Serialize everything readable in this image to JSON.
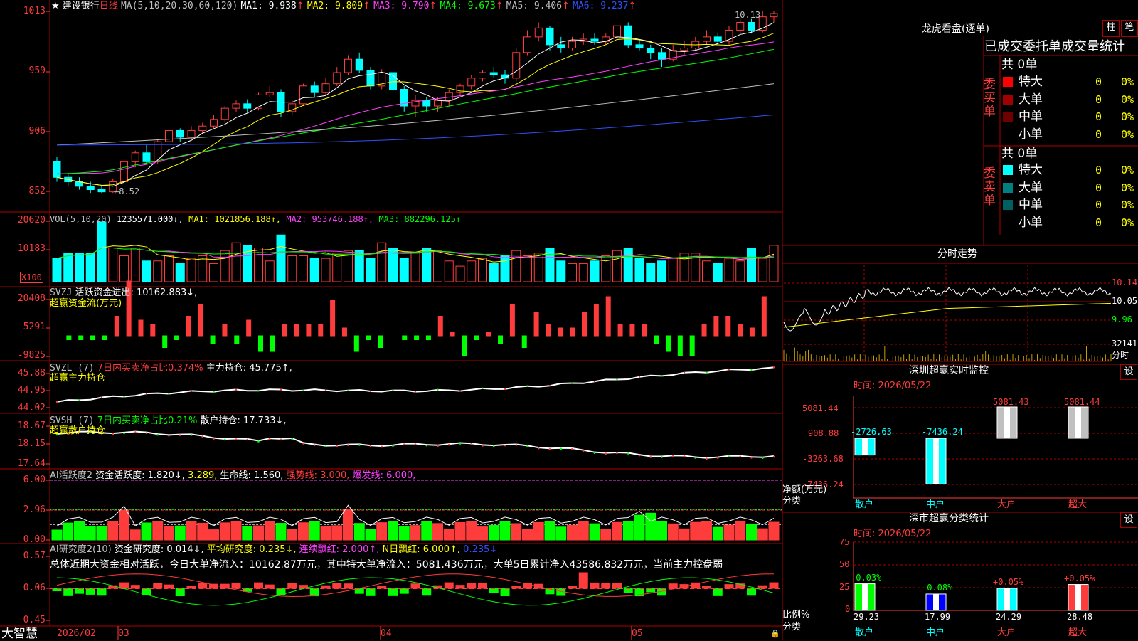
{
  "colors": {
    "up": "#ff3c3c",
    "down": "#00ffff",
    "ma1": "#ffffff",
    "ma2": "#ffff00",
    "ma3": "#ff40ff",
    "ma4": "#00ff00",
    "ma5": "#c0c0c0",
    "ma6": "#3050ff",
    "grid": "#a00000"
  },
  "header": {
    "star": "★",
    "stock_name": "建设银行",
    "period": "日线",
    "ma_label": "MA(5,10,20,30,60,120)",
    "ma1": "MA1: 9.938",
    "ma2": "MA2: 9.809",
    "ma3": "MA3: 9.790",
    "ma4": "MA4: 9.673",
    "ma5": "MA5: 9.406",
    "ma6": "MA6: 9.237",
    "arrow": "↑"
  },
  "price_axis": [
    "1013",
    "959",
    "906",
    "852"
  ],
  "price_high_label": "10.13",
  "price_low_label": "←8.52",
  "vol": {
    "label": "VOL(5,10,20)",
    "value": "1235571.000↓,",
    "ma1": "MA1: 1021856.188↑,",
    "ma2": "MA2: 953746.188↑,",
    "ma3": "MA3: 882296.125↑",
    "axis": [
      "20620",
      "10183"
    ],
    "unit": "X100"
  },
  "svzj": {
    "label": "SVZJ",
    "title": "活跃资金进出: 10162.883↓,",
    "sub": "超赢资金流(万元)",
    "axis": [
      "20408",
      "5291",
      "-9825"
    ]
  },
  "svzl": {
    "label": "SVZL (7)",
    "pct": "7日内买卖净占比0.374%",
    "hold": "主力持仓: 45.775↑,",
    "sub": "超赢主力持仓",
    "axis": [
      "45.88",
      "44.95",
      "44.02"
    ]
  },
  "svsh": {
    "label": "SVSH (7)",
    "pct": "7日内买卖净占比0.21%",
    "hold": "散户持仓: 17.733↓,",
    "sub": "超赢散户持仓",
    "axis": [
      "18.67",
      "18.15",
      "17.64"
    ]
  },
  "ai1": {
    "label": "AI活跃度2",
    "a": "资金活跃度: 1.820↓,",
    "b": "3.289,",
    "c": "生命线: 1.560,",
    "d": "强势线: 3.000,",
    "e": "爆发线: 6.000,",
    "axis": [
      "6.00",
      "2.96",
      "0.00"
    ]
  },
  "ai2": {
    "label": "AI研究度2(10)",
    "a": "资金研究度: 0.014↓,",
    "b": "平均研究度: 0.235↓,",
    "c": "连续飘红: 2.000↑,",
    "d": "N日飘红: 6.000↑,",
    "e": "0.235↓",
    "summary": "总体近期大资金相对活跃，今日大单净流入：10162.87万元，其中特大单净流入：5081.436万元，大单5日累计净入43586.832万元，当前主力控盘弱",
    "axis": [
      "0.57",
      "0.06",
      "-0.45"
    ]
  },
  "bottom_axis": {
    "brand": "大智慧",
    "dates": [
      "2026/02",
      "03",
      "04",
      "05"
    ]
  },
  "longhu": {
    "title": "龙虎看盘(逐单)",
    "btn1": "柱",
    "btn2": "笔",
    "tabs": "已成交委托单成交量统计",
    "buy_count": "共 0单",
    "sell_count": "共 0单",
    "buy_side": "委买单",
    "sell_side": "委卖单",
    "buy_rows": [
      {
        "name": "特大",
        "val": "0",
        "pct": "0%",
        "color": "#ff0000"
      },
      {
        "name": "大单",
        "val": "0",
        "pct": "0%",
        "color": "#a00000"
      },
      {
        "name": "中单",
        "val": "0",
        "pct": "0%",
        "color": "#700000"
      },
      {
        "name": "小单",
        "val": "0",
        "pct": "0%",
        "color": "#000000"
      }
    ],
    "sell_rows": [
      {
        "name": "特大",
        "val": "0",
        "pct": "0%",
        "color": "#00ffff"
      },
      {
        "name": "大单",
        "val": "0",
        "pct": "0%",
        "color": "#008080"
      },
      {
        "name": "中单",
        "val": "0",
        "pct": "0%",
        "color": "#006060"
      },
      {
        "name": "小单",
        "val": "0",
        "pct": "0%",
        "color": "#000000"
      }
    ]
  },
  "intraday": {
    "title": "分时走势",
    "axis": [
      "10.14",
      "10.05",
      "9.96",
      "32141"
    ],
    "foot": "分时"
  },
  "sz_monitor": {
    "title": "深圳超赢实时监控",
    "btn": "设",
    "time": "时间: 2026/05/22",
    "axis": [
      "5081.44",
      "908.88",
      "-3263.68",
      "-7436.24"
    ],
    "ylabel": "净额(万元)",
    "xlabel": "分类",
    "bars": [
      {
        "name": "散户",
        "value": -2726.63,
        "label": "-2726.63"
      },
      {
        "name": "中户",
        "value": -7436.24,
        "label": "-7436.24"
      },
      {
        "name": "大户",
        "value": 5081.43,
        "label": "5081.43"
      },
      {
        "name": "超大",
        "value": 5081.44,
        "label": "5081.44"
      }
    ]
  },
  "sz_class": {
    "title": "深市超赢分类统计",
    "btn": "设",
    "time": "时间: 2026/05/22",
    "axis": [
      "75",
      "50",
      "25",
      "0"
    ],
    "ylabel": "比例%",
    "xlabel": "分类",
    "bars": [
      {
        "name": "散户",
        "value": 29.23,
        "label": "29.23",
        "chg": "-0.03%"
      },
      {
        "name": "中户",
        "value": 17.99,
        "label": "17.99",
        "chg": "-0.08%"
      },
      {
        "name": "大户",
        "value": 24.29,
        "label": "24.29",
        "chg": "+0.05%"
      },
      {
        "name": "超大",
        "value": 28.48,
        "label": "28.48",
        "chg": "+0.05%"
      }
    ]
  },
  "chart_data": [
    {
      "type": "candlestick",
      "title": "建设银行 日线",
      "ylim": [
        8.4,
        10.2
      ],
      "x": [
        "2026/02",
        "03",
        "04",
        "05"
      ],
      "series": [
        {
          "name": "K",
          "values": [
            [
              8.8,
              8.66,
              8.84,
              8.62
            ],
            [
              8.66,
              8.62,
              8.7,
              8.58
            ],
            [
              8.62,
              8.58,
              8.66,
              8.55
            ],
            [
              8.58,
              8.55,
              8.62,
              8.52
            ],
            [
              8.55,
              8.53,
              8.58,
              8.52
            ],
            [
              8.53,
              8.62,
              8.65,
              8.52
            ],
            [
              8.62,
              8.8,
              8.82,
              8.6
            ],
            [
              8.8,
              8.88,
              8.9,
              8.75
            ],
            [
              8.88,
              8.8,
              8.95,
              8.78
            ],
            [
              8.8,
              8.98,
              9.0,
              8.78
            ],
            [
              8.98,
              9.08,
              9.12,
              8.95
            ],
            [
              9.08,
              9.02,
              9.1,
              8.98
            ],
            [
              9.02,
              9.08,
              9.12,
              9.0
            ],
            [
              9.08,
              9.12,
              9.15,
              9.05
            ],
            [
              9.12,
              9.18,
              9.22,
              9.1
            ],
            [
              9.18,
              9.28,
              9.3,
              9.15
            ],
            [
              9.28,
              9.32,
              9.35,
              9.25
            ],
            [
              9.32,
              9.28,
              9.36,
              9.24
            ],
            [
              9.28,
              9.4,
              9.42,
              9.26
            ],
            [
              9.4,
              9.42,
              9.48,
              9.38
            ],
            [
              9.42,
              9.25,
              9.45,
              9.2
            ],
            [
              9.25,
              9.32,
              9.35,
              9.22
            ],
            [
              9.32,
              9.48,
              9.5,
              9.3
            ],
            [
              9.48,
              9.42,
              9.52,
              9.38
            ],
            [
              9.42,
              9.5,
              9.55,
              9.4
            ],
            [
              9.5,
              9.6,
              9.65,
              9.48
            ],
            [
              9.6,
              9.72,
              9.75,
              9.58
            ],
            [
              9.72,
              9.62,
              9.78,
              9.6
            ],
            [
              9.62,
              9.48,
              9.65,
              9.45
            ],
            [
              9.48,
              9.6,
              9.63,
              9.45
            ],
            [
              9.6,
              9.45,
              9.62,
              9.4
            ],
            [
              9.45,
              9.3,
              9.48,
              9.25
            ],
            [
              9.3,
              9.35,
              9.4,
              9.2
            ],
            [
              9.35,
              9.3,
              9.38,
              9.25
            ],
            [
              9.3,
              9.35,
              9.38,
              9.25
            ],
            [
              9.35,
              9.42,
              9.45,
              9.3
            ],
            [
              9.42,
              9.48,
              9.5,
              9.38
            ],
            [
              9.48,
              9.55,
              9.58,
              9.45
            ],
            [
              9.55,
              9.6,
              9.62,
              9.52
            ],
            [
              9.6,
              9.58,
              9.65,
              9.55
            ],
            [
              9.58,
              9.55,
              9.62,
              9.5
            ],
            [
              9.55,
              9.78,
              9.82,
              9.52
            ],
            [
              9.78,
              9.92,
              9.98,
              9.75
            ],
            [
              9.92,
              10.0,
              10.05,
              9.88
            ],
            [
              10.0,
              9.85,
              10.02,
              9.8
            ],
            [
              9.85,
              9.82,
              9.92,
              9.78
            ],
            [
              9.82,
              9.88,
              9.92,
              9.8
            ],
            [
              9.88,
              9.9,
              9.95,
              9.85
            ],
            [
              9.9,
              9.88,
              9.95,
              9.85
            ],
            [
              9.88,
              9.92,
              9.95,
              9.85
            ],
            [
              9.92,
              10.02,
              10.05,
              9.9
            ],
            [
              10.02,
              9.85,
              10.05,
              9.82
            ],
            [
              9.85,
              9.82,
              9.9,
              9.8
            ],
            [
              9.82,
              9.78,
              9.85,
              9.72
            ],
            [
              9.78,
              9.72,
              9.82,
              9.65
            ],
            [
              9.72,
              9.8,
              9.85,
              9.7
            ],
            [
              9.8,
              9.82,
              9.88,
              9.75
            ],
            [
              9.82,
              9.88,
              9.92,
              9.8
            ],
            [
              9.88,
              9.92,
              9.98,
              9.85
            ],
            [
              9.92,
              9.88,
              9.96,
              9.85
            ],
            [
              9.88,
              9.98,
              10.02,
              9.85
            ],
            [
              9.98,
              10.05,
              10.08,
              9.95
            ],
            [
              10.05,
              9.98,
              10.08,
              9.95
            ],
            [
              9.98,
              10.1,
              10.15,
              9.96
            ],
            [
              10.1,
              10.13,
              10.15,
              10.05
            ]
          ]
        }
      ]
    },
    {
      "type": "bar",
      "title": "VOL(5,10,20)",
      "series": [
        {
          "name": "VOL",
          "values": [
            9,
            11,
            11,
            11,
            23,
            13,
            10,
            13,
            8,
            8,
            10,
            7,
            9,
            10,
            7,
            12,
            15,
            14,
            13,
            8,
            18,
            10,
            10,
            9,
            9,
            11,
            12,
            12,
            9,
            15,
            13,
            9,
            11,
            13,
            12,
            8,
            6,
            8,
            9,
            7,
            10,
            12,
            10,
            11,
            13,
            8,
            7,
            7,
            8,
            10,
            12,
            13,
            9,
            7,
            8,
            9,
            11,
            11,
            8,
            7,
            9,
            8,
            13,
            9,
            14
          ]
        }
      ]
    },
    {
      "type": "bar",
      "title": "活跃资金进出",
      "series": [
        {
          "name": "SVZJ",
          "values": [
            0,
            -1,
            -1,
            -1,
            -1,
            5,
            14,
            4,
            3,
            -3,
            -1,
            5,
            8,
            -2,
            3,
            -2,
            4,
            -4,
            -4,
            3,
            3,
            3,
            3,
            9,
            2,
            -4,
            -1,
            -3,
            0,
            -1,
            -1,
            -1,
            5,
            1,
            -5,
            -1,
            1,
            -2,
            8,
            -3,
            6,
            3,
            2,
            2,
            6,
            8,
            10,
            3,
            3,
            3,
            -2,
            -4,
            -5,
            -5,
            3,
            5,
            5,
            3,
            2,
            10,
            5
          ]
        }
      ]
    },
    {
      "type": "line",
      "title": "主力持仓",
      "ylim": [
        44.02,
        45.88
      ]
    },
    {
      "type": "line",
      "title": "散户持仓",
      "ylim": [
        17.64,
        18.67
      ]
    },
    {
      "type": "bar",
      "title": "AI活跃度2",
      "ylim": [
        0,
        6
      ]
    },
    {
      "type": "bar",
      "title": "AI研究度2(10)",
      "ylim": [
        -0.45,
        0.57
      ]
    }
  ]
}
